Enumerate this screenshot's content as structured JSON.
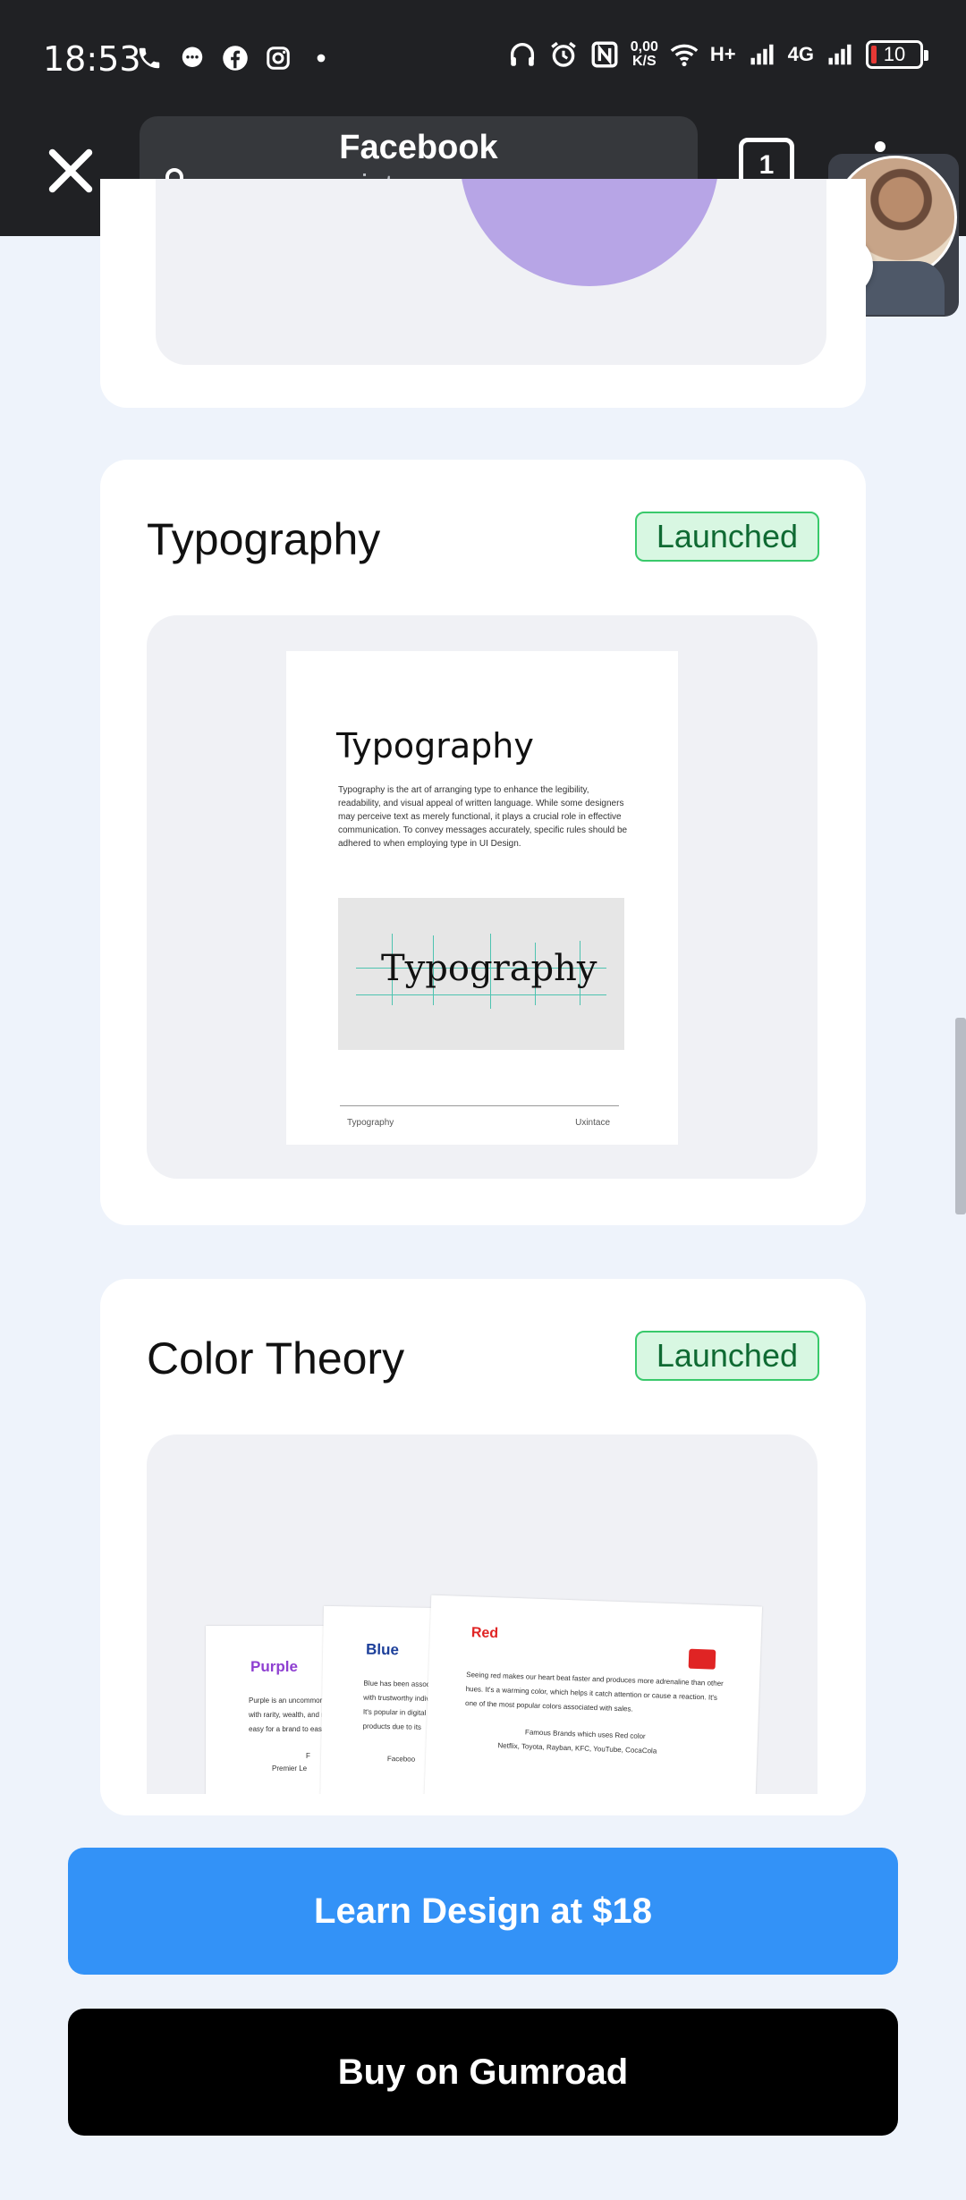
{
  "status_bar": {
    "time": "18:53",
    "left_icons": [
      "phone-icon",
      "chat-bubble-icon",
      "facebook-icon",
      "instagram-icon",
      "dot-icon"
    ],
    "speed_top": "0,00",
    "speed_bottom": "K/S",
    "network_1": "H+",
    "network_2": "4G",
    "battery": "10",
    "colors": {
      "background": "#202124",
      "battery_low": "#e53935"
    }
  },
  "browser": {
    "title": "Facebook",
    "host": "uxintace.com",
    "tab_count": "1"
  },
  "cards": [
    {
      "title": "Typography",
      "badge": "Launched",
      "doc": {
        "title": "Typography",
        "body": "Typography is the art of arranging type to enhance the legibility, readability, and visual appeal of written language. While some designers may perceive text as merely functional, it plays a crucial role in effective communication. To convey messages accurately, specific rules should be adhered to when employing type in UI Design.",
        "figure_word": "Typography",
        "footer_left": "Typography",
        "footer_right": "Uxintace"
      }
    },
    {
      "title": "Color Theory",
      "badge": "Launched",
      "pages": [
        {
          "name": "Purple",
          "text": "Purple is an uncommon color often associated with rarity, wealth, and royalty, which makes it easy for a brand to easily stand out.",
          "foot1": "F",
          "foot2": "Premier Le"
        },
        {
          "name": "Blue",
          "text": "Blue has been associated with trustworthy individuals. It's popular in digital products due to its widespread appeal.",
          "foot1": "Faceboo"
        },
        {
          "name": "Red",
          "text": "Seeing red makes our heart beat faster and produces more adrenaline than other hues. It's a warming color, which helps it catch attention or cause a reaction. It's one of the most popular colors associated with sales.",
          "foot1": "Famous Brands which uses Red color",
          "foot2": "Netflix, Toyota, Rayban, KFC, YouTube, CocaCola"
        }
      ]
    }
  ],
  "buttons": {
    "learn": "Learn Design at $18",
    "buy": "Buy on Gumroad"
  },
  "colors": {
    "page_bg": "#eef3fb",
    "accent_blue": "#3392f7",
    "badge_green": "#39c96b",
    "purple": "#8e3fd1",
    "blue": "#1c3f9a",
    "red": "#e02424"
  }
}
